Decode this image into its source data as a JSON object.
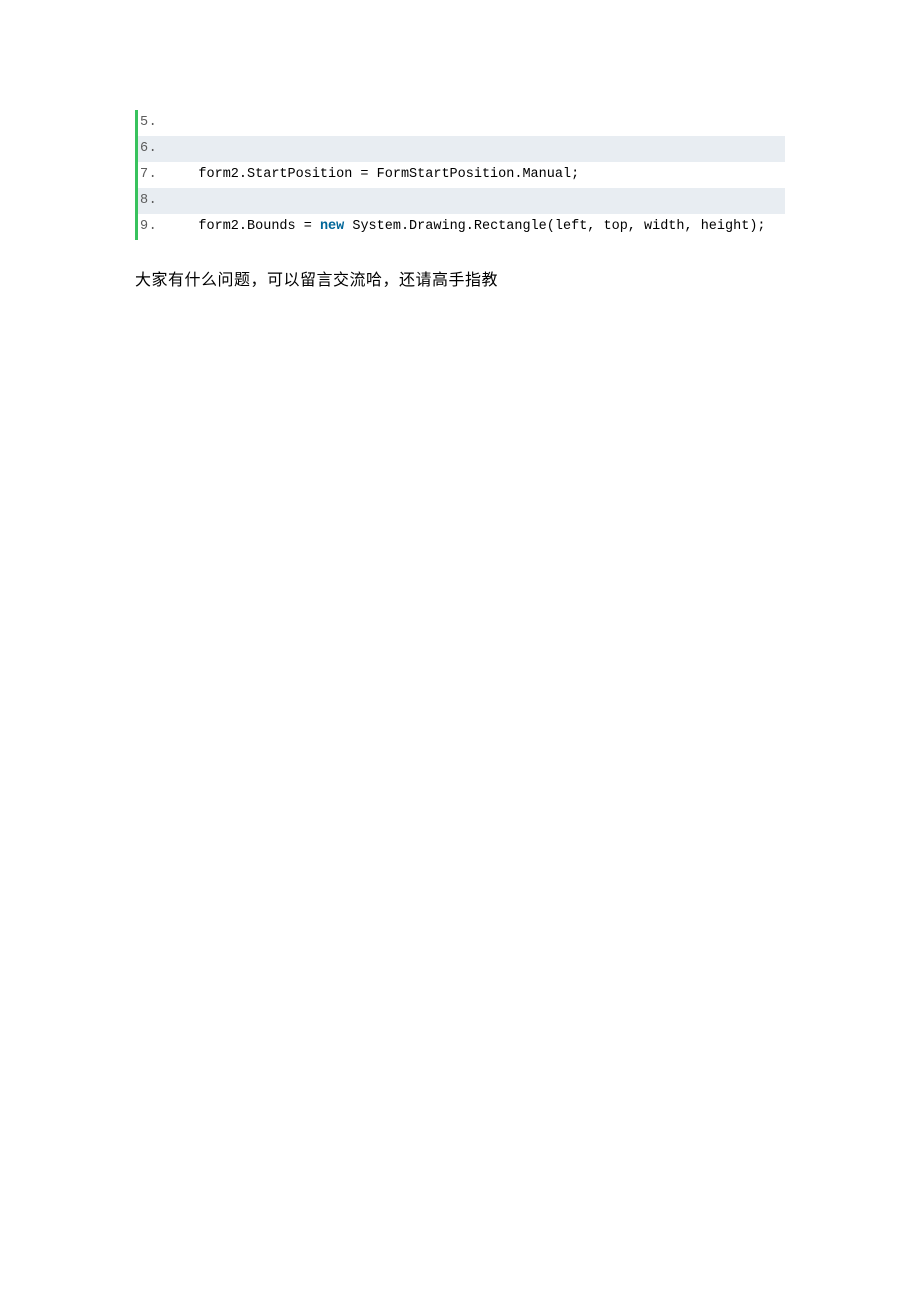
{
  "code": {
    "lines": [
      {
        "num": "5.",
        "content": ""
      },
      {
        "num": "6.",
        "content": ""
      },
      {
        "num": "7.",
        "content": "    form2.StartPosition = FormStartPosition.Manual;"
      },
      {
        "num": "8.",
        "content": ""
      },
      {
        "num": "9.",
        "prefix": "    form2.Bounds = ",
        "keyword": "new",
        "suffix": " System.Drawing.Rectangle(left, top, width, height);"
      }
    ]
  },
  "paragraph_text": "大家有什么问题，可以留言交流哈，还请高手指教"
}
